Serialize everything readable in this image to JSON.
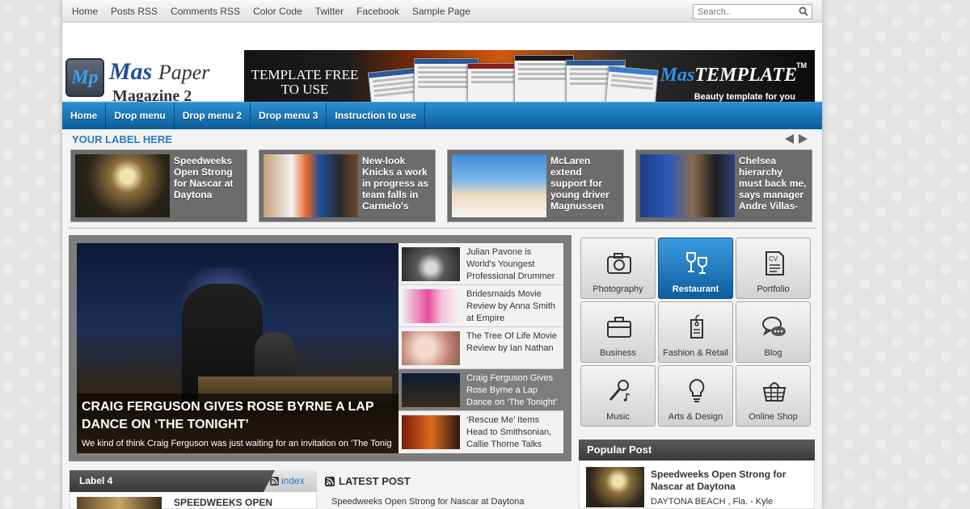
{
  "topnav": {
    "links": [
      "Home",
      "Posts RSS",
      "Comments RSS",
      "Color Code",
      "Twitter",
      "Facebook",
      "Sample Page"
    ],
    "search_placeholder": "Search.."
  },
  "header": {
    "logo_mark": "Mp",
    "logo_mas": "Mas",
    "logo_paper": "Paper",
    "logo_sub": "Magazine 2",
    "banner_left": "TEMPLATE FREE\nTO USE",
    "banner_brand_mas": "Mas",
    "banner_brand_rest": "TEMPLATE",
    "banner_tm": "TM",
    "banner_tag": "Beauty template for you"
  },
  "mainnav": [
    "Home",
    "Drop menu",
    "Drop menu 2",
    "Drop menu 3",
    "Instruction to use"
  ],
  "label_strip": {
    "title": "YOUR LABEL HERE",
    "cards": [
      {
        "text": "Speedweeks Open Strong for Nascar at Daytona"
      },
      {
        "text": "New-look Knicks a work in progress as team falls in Carmelo's"
      },
      {
        "text": "McLaren extend support for young driver Magnussen"
      },
      {
        "text": "Chelsea hierarchy must back me, says manager Andre Villas-"
      }
    ]
  },
  "slider": {
    "hero_title": "CRAIG FERGUSON GIVES ROSE BYRNE A LAP DANCE ON ‘THE TONIGHT’",
    "hero_desc": "We kind of think Craig Ferguson was just waiting for an invitation on ‘The Tonight",
    "items": [
      {
        "text": "Julian Pavone is World's Youngest Professional Drummer",
        "active": false
      },
      {
        "text": "Bridesmaids Movie Review by Anna Smith at Empire",
        "active": false
      },
      {
        "text": "The Tree Of Life Movie Review by Ian Nathan",
        "active": false
      },
      {
        "text": "Craig Ferguson Gives Rose Byrne a Lap Dance on ‘The Tonight’",
        "active": true
      },
      {
        "text": "‘Rescue Me’ Items Head to Smithsonian, Callie Thorne Talks",
        "active": false
      }
    ]
  },
  "icon_grid": [
    {
      "label": "Photography",
      "icon": "camera-icon",
      "active": false
    },
    {
      "label": "Restaurant",
      "icon": "wine-glasses-icon",
      "active": true
    },
    {
      "label": "Portfolio",
      "icon": "cv-document-icon",
      "active": false
    },
    {
      "label": "Business",
      "icon": "briefcase-icon",
      "active": false
    },
    {
      "label": "Fashion & Retail",
      "icon": "price-tag-icon",
      "active": false
    },
    {
      "label": "Blog",
      "icon": "chat-bubbles-icon",
      "active": false
    },
    {
      "label": "Music",
      "icon": "microphone-icon",
      "active": false
    },
    {
      "label": "Arts & Design",
      "icon": "lightbulb-icon",
      "active": false
    },
    {
      "label": "Online Shop",
      "icon": "shopping-basket-icon",
      "active": false
    }
  ],
  "popular": {
    "title": "Popular Post",
    "post_title": "Speedweeks Open Strong for Nascar at Daytona",
    "post_desc": "DAYTONA BEACH , Fla. - Kyle"
  },
  "label4": {
    "title": "Label 4",
    "tab": "index",
    "post_title": "SPEEDWEEKS OPEN"
  },
  "latest": {
    "title": "LATEST POST",
    "item": "Speedweeks Open Strong for Nascar at Daytona"
  },
  "colors": {
    "accent": "#1f78c1",
    "nav": "#0c5c98",
    "dark_bar": "#444444"
  }
}
